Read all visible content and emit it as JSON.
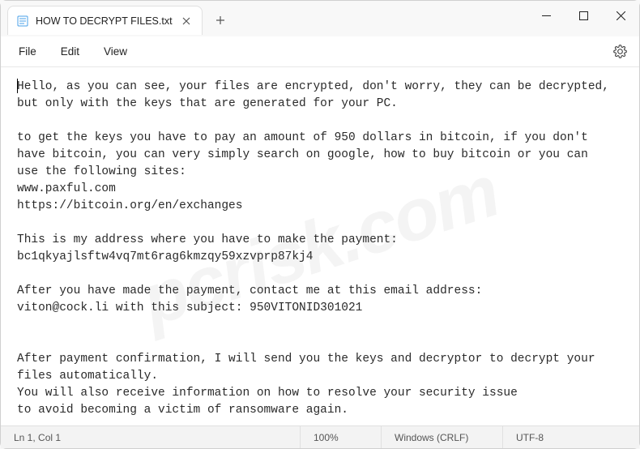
{
  "tab": {
    "title": "HOW TO DECRYPT FILES.txt"
  },
  "menu": {
    "file": "File",
    "edit": "Edit",
    "view": "View"
  },
  "content": {
    "text": "Hello, as you can see, your files are encrypted, don't worry, they can be decrypted,\nbut only with the keys that are generated for your PC.\n\nto get the keys you have to pay an amount of 950 dollars in bitcoin, if you don't\nhave bitcoin, you can very simply search on google, how to buy bitcoin or you can\nuse the following sites:\nwww.paxful.com\nhttps://bitcoin.org/en/exchanges\n\nThis is my address where you have to make the payment:\nbc1qkyajlsftw4vq7mt6rag6kmzqy59xzvprp87kj4\n\nAfter you have made the payment, contact me at this email address:\nviton@cock.li with this subject: 950VITONID301021\n\n\nAfter payment confirmation, I will send you the keys and decryptor to decrypt your\nfiles automatically.\nYou will also receive information on how to resolve your security issue\nto avoid becoming a victim of ransomware again."
  },
  "status": {
    "cursor": "Ln 1, Col 1",
    "zoom": "100%",
    "eol": "Windows (CRLF)",
    "encoding": "UTF-8"
  }
}
